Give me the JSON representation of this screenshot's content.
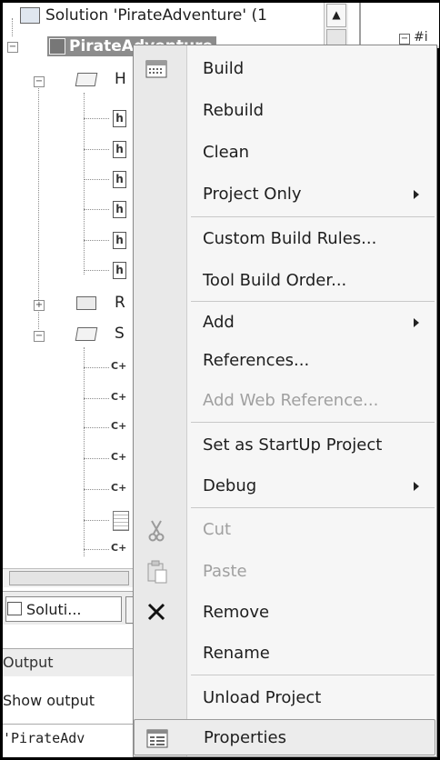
{
  "explorer": {
    "solution_label": "Solution 'PirateAdventure' (1",
    "project_label": "PirateAdventure",
    "folder_headers": "H",
    "folder_resources": "R",
    "folder_sources": "S",
    "header_file_glyph": "h",
    "source_file_glyph": "C+",
    "right_pane_text": "#i",
    "tab_label": "Soluti..."
  },
  "output": {
    "title": "Output",
    "show_output": "Show output",
    "line": "'PirateAdv"
  },
  "context_menu": {
    "items": [
      {
        "label": "Build",
        "icon": "build-icon"
      },
      {
        "label": "Rebuild"
      },
      {
        "label": "Clean"
      },
      {
        "label": "Project Only",
        "submenu": true
      },
      {
        "label": "Custom Build Rules..."
      },
      {
        "label": "Tool Build Order..."
      },
      {
        "label": "Add",
        "submenu": true
      },
      {
        "label": "References..."
      },
      {
        "label": "Add Web Reference...",
        "disabled": true
      },
      {
        "label": "Set as StartUp Project"
      },
      {
        "label": "Debug",
        "submenu": true
      },
      {
        "label": "Cut",
        "disabled": true,
        "icon": "scissors-icon"
      },
      {
        "label": "Paste",
        "disabled": true,
        "icon": "clipboard-icon"
      },
      {
        "label": "Remove",
        "icon": "x-icon"
      },
      {
        "label": "Rename"
      },
      {
        "label": "Unload Project"
      },
      {
        "label": "Properties",
        "icon": "properties-icon",
        "hovered": true
      }
    ]
  }
}
